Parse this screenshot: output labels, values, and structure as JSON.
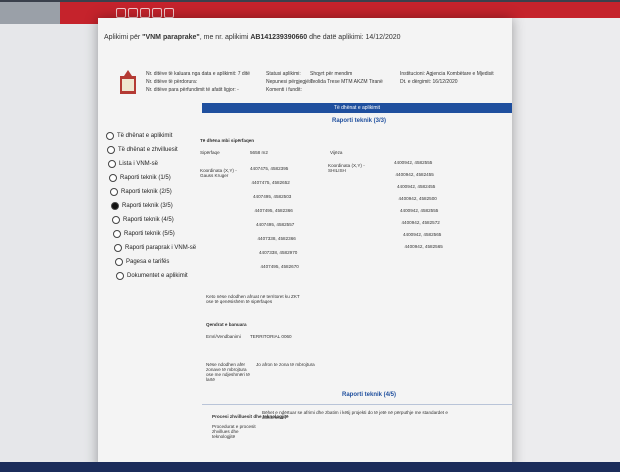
{
  "window": {
    "title_prefix": "Aplikimi për",
    "title_bold": "\"VNM paraprake\"",
    "title_mid": ", me nr. aplikimi",
    "title_number": "AB141239390660",
    "title_suffix": "dhe datë aplikimi: 14/12/2020"
  },
  "summary": {
    "left": [
      "Nr. ditëve të kaluara nga data e aplikimit: 7 ditë",
      "Nr. ditëve të përdorura:",
      "Nr. ditëve para përfundimit të afatit ligjor: -"
    ],
    "mid_labels": [
      "Statusi aplikimi:",
      "Nepunesi përgjegjës:",
      "Komenti i fundit:"
    ],
    "mid_values": [
      "Shqyrt për mendim",
      "Teolida Trese MTM AKZM Tiranë",
      ""
    ],
    "right": [
      "Institucioni: Agjencia Kombëtare e Mjedisit",
      "Dt. e dërgimit: 16/12/2020"
    ]
  },
  "bar_label": "Të dhënat e aplikimit",
  "report_header_1": "Raporti teknik (3/3)",
  "report_header_2": "Raporti teknik (4/5)",
  "nav": [
    {
      "label": "Të dhënat e aplikimit",
      "selected": false
    },
    {
      "label": "Të dhënat e zhvilluesit",
      "selected": false
    },
    {
      "label": "Lista i VNM-së",
      "selected": false
    },
    {
      "label": "Raporti teknik (1/5)",
      "selected": false
    },
    {
      "label": "Raporti teknik (2/5)",
      "selected": false
    },
    {
      "label": "Raporti teknik (3/5)",
      "selected": true
    },
    {
      "label": "Raporti teknik (4/5)",
      "selected": false
    },
    {
      "label": "Raporti teknik (5/5)",
      "selected": false
    },
    {
      "label": "Raporti paraprak i VNM-së",
      "selected": false
    },
    {
      "label": "Pagesa e tarifës",
      "selected": false
    },
    {
      "label": "Dokumentet e aplikimit",
      "selected": false
    }
  ],
  "section": {
    "heading": "Të dhëna mbi sipërfaqen",
    "rows": [
      {
        "label": "Sipërfaqe",
        "value": "5658 m2"
      },
      {
        "label": "Koordinata (X,Y) - Gauss Kruger",
        "value": ""
      }
    ],
    "left_coords": [
      "4407475, 4582395",
      "4407475, 4582652",
      "4407495, 4582503",
      "4407495, 4582366",
      "4407495, 4582557",
      "4407338, 4582366",
      "4407338, 4582970",
      "4407495, 4582670"
    ],
    "right_heading": "Vijëza",
    "right_label": "Koordinata (X,Y) - SHILISH",
    "right_coords": [
      "4400942, 4582555",
      "4400942, 4582455",
      "4400942, 4582455",
      "4400942, 4582500",
      "4400942, 4582555",
      "4400942, 4582572",
      "4400942, 4582565",
      "4400942, 4582565"
    ]
  },
  "extra": {
    "note1": "Keto nëse ndodhen afruat në territoret ku ZKT ose të qenësishëm të sipërfaqes",
    "group": "Qendrat e banuara",
    "near_label": "Emri/Vendbanimi",
    "near_value": "TERRITORIAL 0060",
    "far_label": "Nëse ndodhen afër zonave të mbrojtura ose me ndjeshmëri të lartë",
    "far_value": "Jo afron te zona të mbrojtura"
  },
  "footer": {
    "label": "Procesi zhvilluesit dhe teknologjitë",
    "text1": "Procedurat e procesit zhvillues dhe teknologjitë",
    "text2": "Bëhet e ndërtuar se afrimi dhe zbatim i këtij projekti do të jetë në përputhje me standardet e dokumentet"
  }
}
